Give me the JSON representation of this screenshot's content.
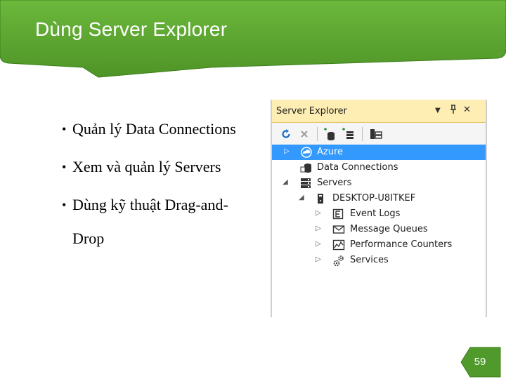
{
  "slide": {
    "title": "Dùng Server Explorer",
    "bullets": [
      "Quản lý Data Connections",
      "Xem và quản lý Servers",
      "Dùng kỹ thuật  Drag-and-",
      "Drop"
    ],
    "page_number": "59",
    "colors": {
      "banner": "#5fa832",
      "banner_dark": "#3d7f1c",
      "page_badge": "#4f9a2a"
    }
  },
  "server_explorer": {
    "title": "Server Explorer",
    "controls": {
      "dropdown": "▼",
      "pin": "⊥",
      "close": "✕"
    },
    "toolbar": [
      "refresh-icon",
      "stop-icon",
      "connect-to-database-icon",
      "connect-to-server-icon",
      "connect-to-sharepoint-icon"
    ],
    "tree": [
      {
        "label": "Azure",
        "icon": "azure-cloud-icon",
        "level": 0,
        "expander": "▷",
        "selected": true
      },
      {
        "label": "Data Connections",
        "icon": "database-icon",
        "level": 0,
        "expander": "",
        "selected": false
      },
      {
        "label": "Servers",
        "icon": "servers-icon",
        "level": 0,
        "expander": "◢",
        "selected": false
      },
      {
        "label": "DESKTOP-U8ITKEF",
        "icon": "computer-icon",
        "level": 1,
        "expander": "◢",
        "selected": false
      },
      {
        "label": "Event Logs",
        "icon": "event-log-icon",
        "level": 2,
        "expander": "▷",
        "selected": false
      },
      {
        "label": "Message Queues",
        "icon": "message-queue-icon",
        "level": 2,
        "expander": "▷",
        "selected": false
      },
      {
        "label": "Performance Counters",
        "icon": "performance-counter-icon",
        "level": 2,
        "expander": "▷",
        "selected": false
      },
      {
        "label": "Services",
        "icon": "services-gear-icon",
        "level": 2,
        "expander": "▷",
        "selected": false
      }
    ]
  }
}
